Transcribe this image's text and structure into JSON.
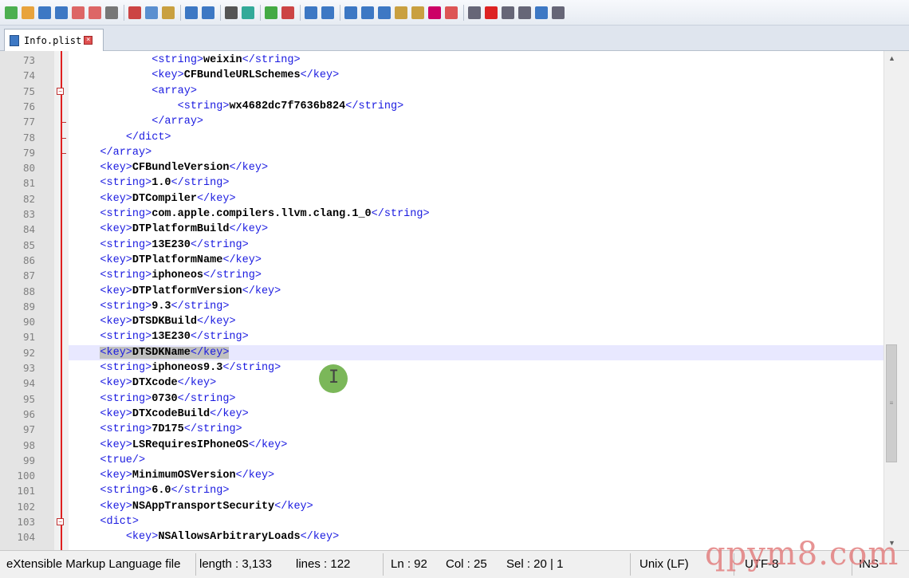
{
  "tab": {
    "label": "Info.plist"
  },
  "toolbar_icons": [
    "new-file-icon",
    "open-file-icon",
    "save-icon",
    "save-all-icon",
    "close-icon",
    "close-all-icon",
    "print-icon",
    "cut-icon",
    "copy-icon",
    "paste-icon",
    "undo-icon",
    "redo-icon",
    "find-icon",
    "replace-icon",
    "zoom-in-icon",
    "zoom-out-icon",
    "sync-v-icon",
    "sync-h-icon",
    "word-wrap-icon",
    "show-all-chars-icon",
    "indent-guide-icon",
    "udl-icon",
    "doc-map-icon",
    "function-list-icon",
    "folder-workspace-icon",
    "monitor-icon",
    "record-macro-icon",
    "stop-record-icon",
    "play-macro-icon",
    "run-macro-multiple-icon",
    "save-macro-icon"
  ],
  "lines": [
    {
      "num": "73",
      "indent": "            ",
      "open": "<string>",
      "text": "weixin",
      "close": "</string>"
    },
    {
      "num": "74",
      "indent": "            ",
      "open": "<key>",
      "text": "CFBundleURLSchemes",
      "close": "</key>"
    },
    {
      "num": "75",
      "indent": "            ",
      "open": "<array>",
      "text": "",
      "close": ""
    },
    {
      "num": "76",
      "indent": "                ",
      "open": "<string>",
      "text": "wx4682dc7f7636b824",
      "close": "</string>"
    },
    {
      "num": "77",
      "indent": "            ",
      "open": "</array>",
      "text": "",
      "close": ""
    },
    {
      "num": "78",
      "indent": "        ",
      "open": "</dict>",
      "text": "",
      "close": ""
    },
    {
      "num": "79",
      "indent": "    ",
      "open": "</array>",
      "text": "",
      "close": ""
    },
    {
      "num": "80",
      "indent": "    ",
      "open": "<key>",
      "text": "CFBundleVersion",
      "close": "</key>"
    },
    {
      "num": "81",
      "indent": "    ",
      "open": "<string>",
      "text": "1.0",
      "close": "</string>"
    },
    {
      "num": "82",
      "indent": "    ",
      "open": "<key>",
      "text": "DTCompiler",
      "close": "</key>"
    },
    {
      "num": "83",
      "indent": "    ",
      "open": "<string>",
      "text": "com.apple.compilers.llvm.clang.1_0",
      "close": "</string>"
    },
    {
      "num": "84",
      "indent": "    ",
      "open": "<key>",
      "text": "DTPlatformBuild",
      "close": "</key>"
    },
    {
      "num": "85",
      "indent": "    ",
      "open": "<string>",
      "text": "13E230",
      "close": "</string>"
    },
    {
      "num": "86",
      "indent": "    ",
      "open": "<key>",
      "text": "DTPlatformName",
      "close": "</key>"
    },
    {
      "num": "87",
      "indent": "    ",
      "open": "<string>",
      "text": "iphoneos",
      "close": "</string>"
    },
    {
      "num": "88",
      "indent": "    ",
      "open": "<key>",
      "text": "DTPlatformVersion",
      "close": "</key>"
    },
    {
      "num": "89",
      "indent": "    ",
      "open": "<string>",
      "text": "9.3",
      "close": "</string>"
    },
    {
      "num": "90",
      "indent": "    ",
      "open": "<key>",
      "text": "DTSDKBuild",
      "close": "</key>"
    },
    {
      "num": "91",
      "indent": "    ",
      "open": "<string>",
      "text": "13E230",
      "close": "</string>"
    },
    {
      "num": "92",
      "indent": "    ",
      "open": "<key>",
      "text": "DTSDKName",
      "close": "</key>",
      "current": true
    },
    {
      "num": "93",
      "indent": "    ",
      "open": "<string>",
      "text": "iphoneos9.3",
      "close": "</string>"
    },
    {
      "num": "94",
      "indent": "    ",
      "open": "<key>",
      "text": "DTXcode",
      "close": "</key>"
    },
    {
      "num": "95",
      "indent": "    ",
      "open": "<string>",
      "text": "0730",
      "close": "</string>"
    },
    {
      "num": "96",
      "indent": "    ",
      "open": "<key>",
      "text": "DTXcodeBuild",
      "close": "</key>"
    },
    {
      "num": "97",
      "indent": "    ",
      "open": "<string>",
      "text": "7D175",
      "close": "</string>"
    },
    {
      "num": "98",
      "indent": "    ",
      "open": "<key>",
      "text": "LSRequiresIPhoneOS",
      "close": "</key>"
    },
    {
      "num": "99",
      "indent": "    ",
      "open": "<true/>",
      "text": "",
      "close": ""
    },
    {
      "num": "100",
      "indent": "    ",
      "open": "<key>",
      "text": "MinimumOSVersion",
      "close": "</key>"
    },
    {
      "num": "101",
      "indent": "    ",
      "open": "<string>",
      "text": "6.0",
      "close": "</string>"
    },
    {
      "num": "102",
      "indent": "    ",
      "open": "<key>",
      "text": "NSAppTransportSecurity",
      "close": "</key>"
    },
    {
      "num": "103",
      "indent": "    ",
      "open": "<dict>",
      "text": "",
      "close": ""
    },
    {
      "num": "104",
      "indent": "        ",
      "open": "<key>",
      "text": "NSAllowsArbitraryLoads",
      "close": "</key>"
    }
  ],
  "status": {
    "language": "eXtensible Markup Language file",
    "length": "length : 3,133",
    "lines": "lines : 122",
    "ln": "Ln : 92",
    "col": "Col : 25",
    "sel": "Sel : 20 | 1",
    "eol": "Unix (LF)",
    "encoding": "UTF-8",
    "mode": "INS"
  },
  "watermark": "qpym8.com",
  "colors": {
    "tag": "#1a1ae0",
    "current_line": "#e8e8ff",
    "selection": "#c0c0c0",
    "fold_line": "#e02020"
  }
}
